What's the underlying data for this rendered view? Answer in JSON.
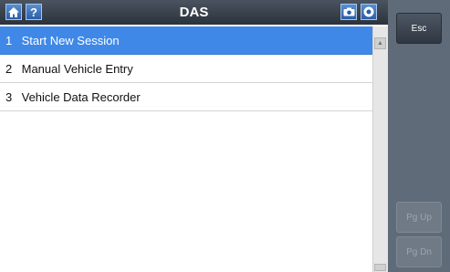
{
  "titlebar": {
    "title": "DAS",
    "home_icon": "home-icon",
    "help_label": "?",
    "camera_icon": "camera-icon",
    "record_icon": "record-icon",
    "accent": "#3f88e8"
  },
  "menu": {
    "items": [
      {
        "num": "1",
        "label": "Start New Session",
        "selected": true
      },
      {
        "num": "2",
        "label": "Manual Vehicle Entry",
        "selected": false
      },
      {
        "num": "3",
        "label": "Vehicle Data Recorder",
        "selected": false
      }
    ]
  },
  "side": {
    "esc_label": "Esc",
    "pgup_label": "Pg Up",
    "pgdn_label": "Pg Dn"
  }
}
